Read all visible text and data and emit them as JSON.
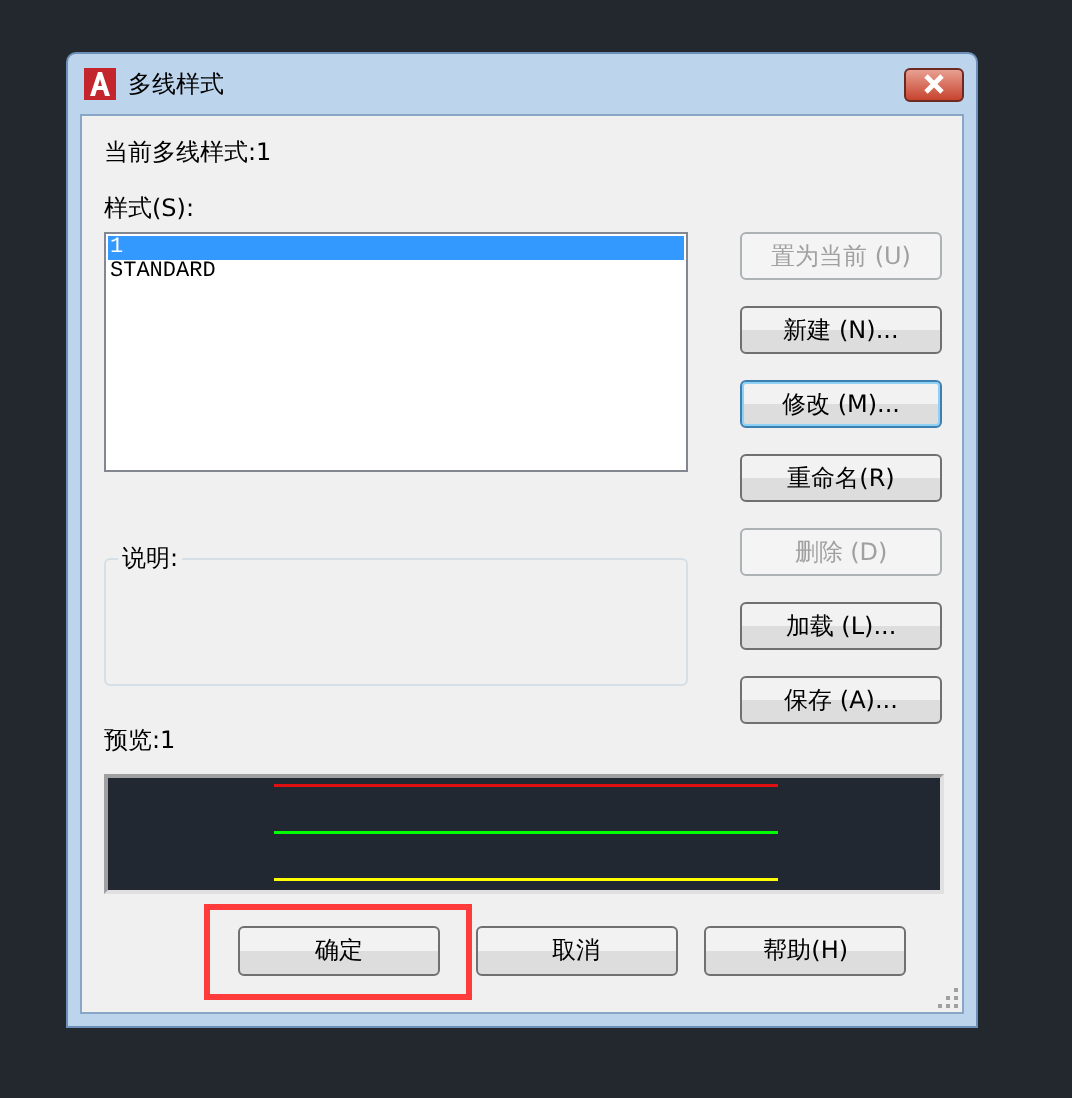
{
  "window": {
    "title": "多线样式"
  },
  "current_style": "当前多线样式:1",
  "styles_label": "样式(S):",
  "styles": [
    {
      "name": "1",
      "selected": true
    },
    {
      "name": "STANDARD",
      "selected": false
    }
  ],
  "side_buttons": [
    {
      "label": "置为当前 (U)",
      "disabled": true,
      "focused": false
    },
    {
      "label": "新建 (N)...",
      "disabled": false,
      "focused": false
    },
    {
      "label": "修改 (M)...",
      "disabled": false,
      "focused": true
    },
    {
      "label": "重命名(R)",
      "disabled": false,
      "focused": false
    },
    {
      "label": "删除 (D)",
      "disabled": true,
      "focused": false
    },
    {
      "label": "加载 (L)...",
      "disabled": false,
      "focused": false
    },
    {
      "label": "保存 (A)...",
      "disabled": false,
      "focused": false
    }
  ],
  "description": {
    "label": "说明:"
  },
  "preview": {
    "label": "预览:1",
    "lines": [
      {
        "color": "#e01010"
      },
      {
        "color": "#00ff00"
      },
      {
        "color": "#ffff00"
      }
    ]
  },
  "bottom_buttons": [
    {
      "label": "确定",
      "highlighted": true
    },
    {
      "label": "取消",
      "highlighted": false
    },
    {
      "label": "帮助(H)",
      "highlighted": false
    }
  ]
}
